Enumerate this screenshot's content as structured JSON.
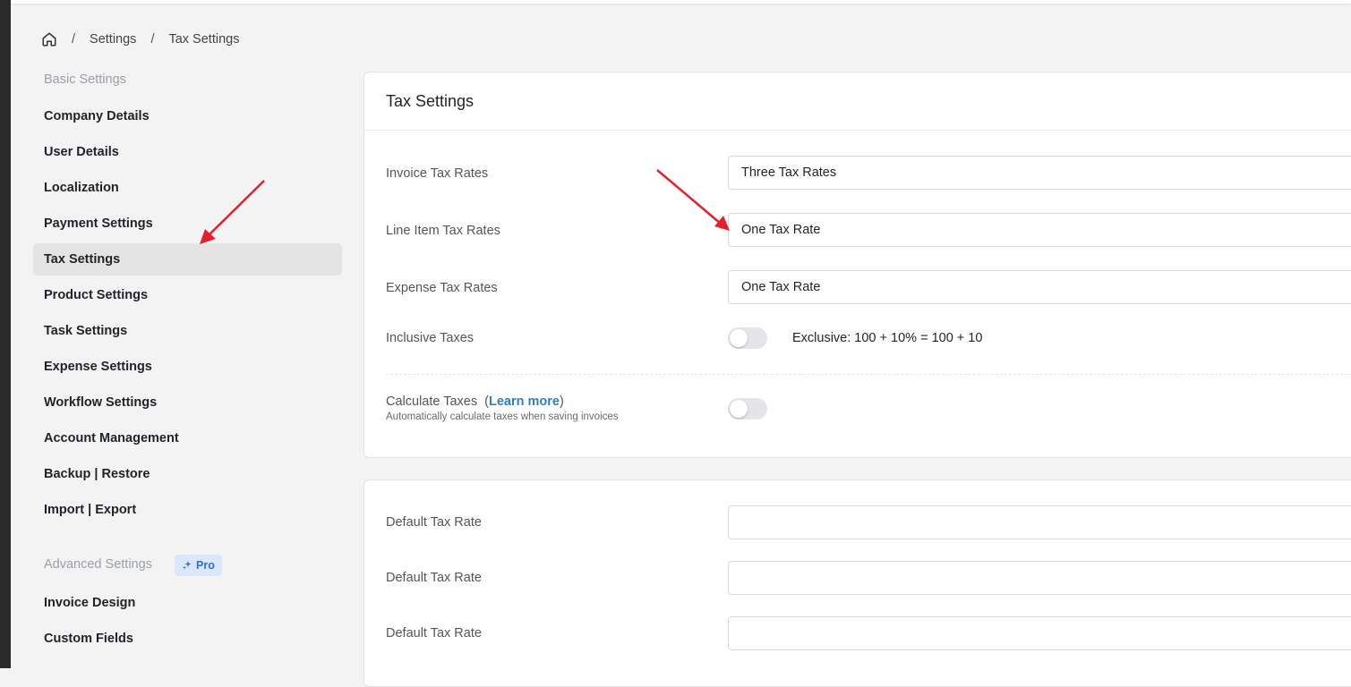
{
  "breadcrumb": {
    "items": [
      "Settings",
      "Tax Settings"
    ],
    "separator": "/"
  },
  "sidebar": {
    "basic_heading": "Basic Settings",
    "items": [
      {
        "label": "Company Details"
      },
      {
        "label": "User Details"
      },
      {
        "label": "Localization"
      },
      {
        "label": "Payment Settings"
      },
      {
        "label": "Tax Settings",
        "active": true
      },
      {
        "label": "Product Settings"
      },
      {
        "label": "Task Settings"
      },
      {
        "label": "Expense Settings"
      },
      {
        "label": "Workflow Settings"
      },
      {
        "label": "Account Management"
      },
      {
        "label": "Backup | Restore"
      },
      {
        "label": "Import | Export"
      }
    ],
    "advanced_heading": "Advanced Settings",
    "pro_badge": "Pro",
    "advanced_items": [
      {
        "label": "Invoice Design"
      },
      {
        "label": "Custom Fields"
      }
    ]
  },
  "tax_card": {
    "title": "Tax Settings",
    "invoice_tax_rates": {
      "label": "Invoice Tax Rates",
      "value": "Three Tax Rates"
    },
    "line_item_tax_rates": {
      "label": "Line Item Tax Rates",
      "value": "One Tax Rate"
    },
    "expense_tax_rates": {
      "label": "Expense Tax Rates",
      "value": "One Tax Rate"
    },
    "inclusive_taxes": {
      "label": "Inclusive Taxes",
      "enabled": false,
      "help": "Exclusive: 100 + 10% = 100 + 10"
    },
    "calculate_taxes": {
      "label": "Calculate Taxes",
      "paren_open": "(",
      "learn_more": "Learn more",
      "paren_close": ")",
      "description": "Automatically calculate taxes when saving invoices",
      "enabled": false
    }
  },
  "default_card": {
    "rows": [
      {
        "label": "Default Tax Rate",
        "value": ""
      },
      {
        "label": "Default Tax Rate",
        "value": ""
      },
      {
        "label": "Default Tax Rate",
        "value": ""
      }
    ]
  },
  "colors": {
    "accent": "#2f7ec1",
    "annotation_arrow": "#e3202b",
    "active_item_bg": "#e4e4e4"
  }
}
